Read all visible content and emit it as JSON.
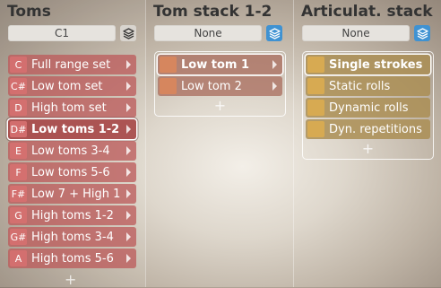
{
  "toms": {
    "title": "Toms",
    "selector_value": "C1",
    "add_symbol": "+",
    "items": [
      {
        "key": "C",
        "label": "Full range set",
        "selected": false
      },
      {
        "key": "C#",
        "label": "Low tom set",
        "selected": false
      },
      {
        "key": "D",
        "label": "High tom set",
        "selected": false
      },
      {
        "key": "D#",
        "label": "Low toms 1-2",
        "selected": true
      },
      {
        "key": "E",
        "label": "Low toms 3-4",
        "selected": false
      },
      {
        "key": "F",
        "label": "Low toms 5-6",
        "selected": false
      },
      {
        "key": "F#",
        "label": "Low 7 + High 1",
        "selected": false
      },
      {
        "key": "G",
        "label": "High toms 1-2",
        "selected": false
      },
      {
        "key": "G#",
        "label": "High toms 3-4",
        "selected": false
      },
      {
        "key": "A",
        "label": "High toms 5-6",
        "selected": false
      }
    ]
  },
  "tom_stack": {
    "title": "Tom stack 1-2",
    "selector_value": "None",
    "add_symbol": "+",
    "items": [
      {
        "label": "Low tom 1",
        "selected": true
      },
      {
        "label": "Low tom 2",
        "selected": false
      }
    ]
  },
  "articulation_stack": {
    "title": "Articulat. stack",
    "selector_value": "None",
    "add_symbol": "+",
    "items": [
      {
        "label": "Single strokes",
        "selected": true
      },
      {
        "label": "Static rolls",
        "selected": false
      },
      {
        "label": "Dynamic rolls",
        "selected": false
      },
      {
        "label": "Dyn. repetitions",
        "selected": false
      }
    ]
  },
  "colors": {
    "tom_item": "#bc5c5c",
    "tom_key": "#d67070",
    "tom_stack_swatch": "#d6865e",
    "artic_swatch": "#d7aa52",
    "stack_icon_active": "#3f92d2"
  },
  "icons": {
    "stack_button": "layers-icon",
    "submenu_arrow": "chevron-right-icon"
  }
}
